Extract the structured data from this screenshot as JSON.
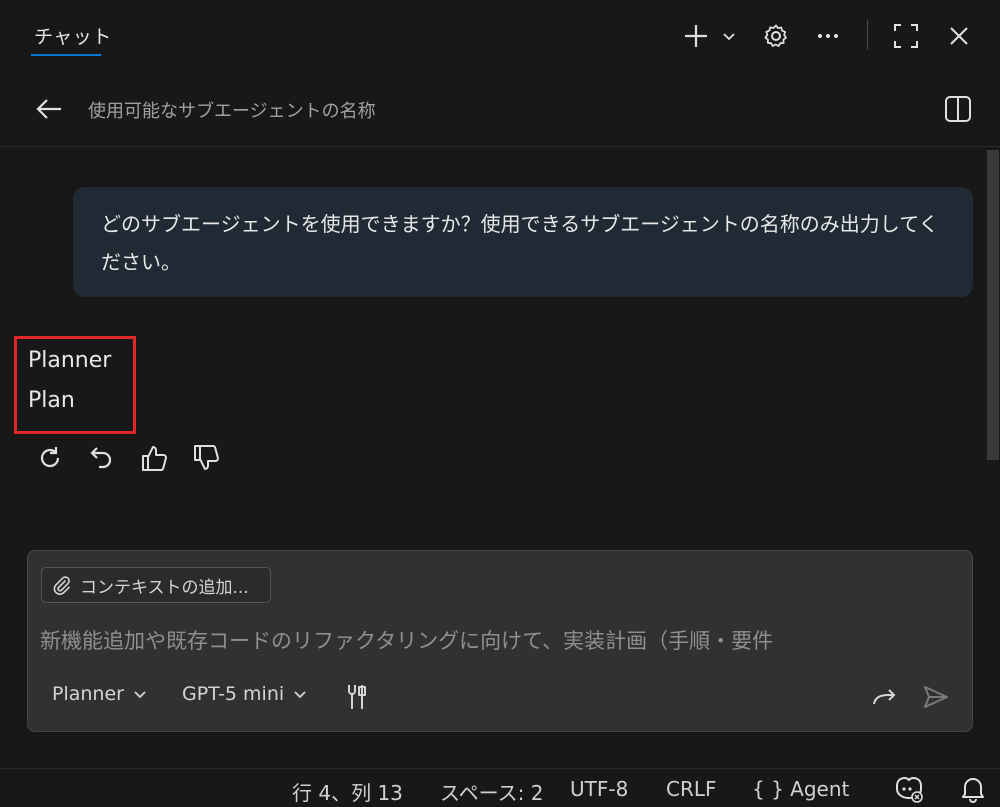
{
  "header": {
    "tab_label": "チャット"
  },
  "session": {
    "title": "使用可能なサブエージェントの名称"
  },
  "conversation": {
    "user_message": "どのサブエージェントを使用できますか？使用できるサブエージェントの名称のみ出力してください。",
    "response_lines": [
      "Planner",
      "Plan"
    ]
  },
  "input": {
    "context_button_label": "コンテキストの追加...",
    "placeholder": "新機能追加や既存コードのリファクタリングに向けて、実装計画（手順・要件",
    "agent_selected": "Planner",
    "model_selected": "GPT-5 mini"
  },
  "status_bar": {
    "cursor_position": "行 4、列 13",
    "indentation": "スペース: 2",
    "encoding": "UTF-8",
    "line_ending": "CRLF",
    "language_mode": "Agent"
  },
  "colors": {
    "background": "#181818",
    "accent": "#0078d4",
    "user_bubble": "#1f2a35",
    "highlight_box": "#e02828"
  }
}
